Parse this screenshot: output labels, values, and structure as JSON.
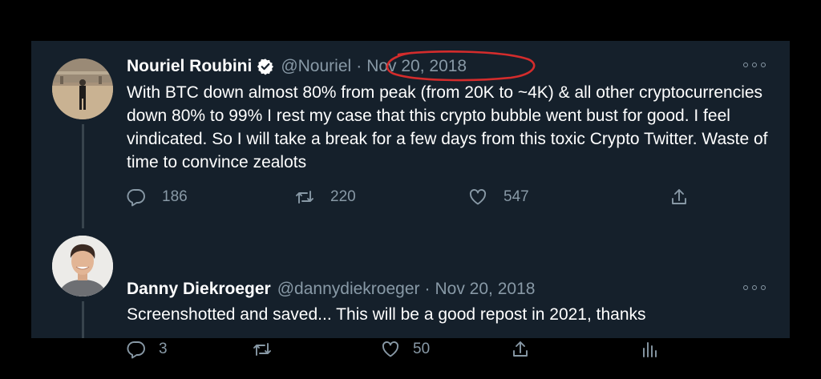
{
  "thread": {
    "tweets": [
      {
        "author_name": "Nouriel Roubini",
        "verified": true,
        "handle": "@Nouriel",
        "separator": "·",
        "date": "Nov 20, 2018",
        "text": "With BTC down almost 80% from peak (from 20K to ~4K) & all other cryptocurrencies down 80% to 99% I rest my case that this crypto bubble went bust for good. I feel vindicated. So I will take a break for a few days from this toxic Crypto Twitter. Waste of time to convince zealots",
        "replies": "186",
        "retweets": "220",
        "likes": "547"
      },
      {
        "author_name": "Danny Diekroeger",
        "verified": false,
        "handle": "@dannydiekroeger",
        "separator": "·",
        "date": "Nov 20, 2018",
        "text": "Screenshotted and saved... This will be a good repost in 2021, thanks",
        "replies": "3",
        "retweets": "",
        "likes": "50"
      }
    ]
  },
  "colors": {
    "background": "#15202b",
    "secondary_text": "#8899a6",
    "primary_text": "#ffffff",
    "verified_badge": "#ffffff",
    "annotation_circle": "#d42c2c"
  },
  "icons": {
    "reply": "reply-bubble-icon",
    "retweet": "retweet-arrows-icon",
    "like": "heart-icon",
    "share": "share-upload-icon",
    "analytics": "analytics-bars-icon",
    "more": "more-dots-icon",
    "verified": "verified-badge-icon"
  }
}
